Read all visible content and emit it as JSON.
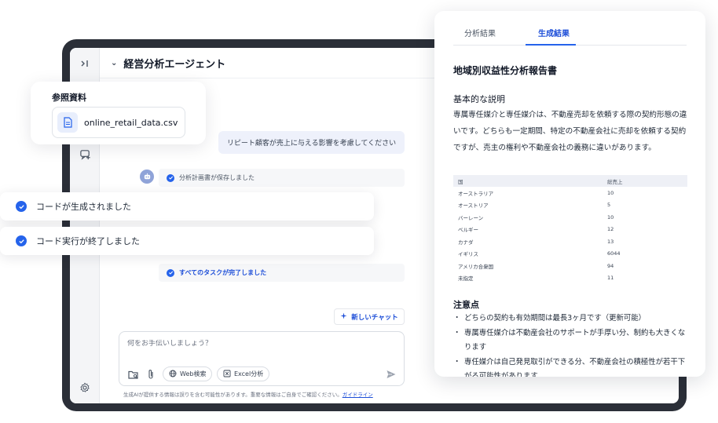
{
  "app": {
    "title": "経営分析エージェント"
  },
  "chat": {
    "user_message": "リピート顧客が売上に与える影響を考慮してください",
    "status_plan_saved": "分析計画書が保存しました",
    "status_all_done": "すべてのタスクが完了しました",
    "new_chat_label": "新しいチャット",
    "input_placeholder": "何をお手伝いしましょう？",
    "web_search_label": "Web検索",
    "excel_label": "Excel分析",
    "disclaimer": "生成AIが提供する情報は誤りを含む可能性があります。重要な情報はご自身でご確認ください。",
    "guideline_link": "ガイドライン"
  },
  "reference": {
    "title": "参照資料",
    "file_name": "online_retail_data.csv"
  },
  "toasts": {
    "code_generated": "コードが生成されました",
    "code_executed": "コード実行が終了しました"
  },
  "panel": {
    "tab_analysis": "分析結果",
    "tab_generated": "生成結果",
    "report_title": "地域別収益性分析報告書",
    "section_basic": "基本的な説明",
    "basic_text": "専属専任媒介と専任媒介は、不動産売却を依頼する際の契約形態の違いです。どちらも一定期間、特定の不動産会社に売却を依頼する契約ですが、売主の権利や不動産会社の義務に違いがあります。",
    "table": {
      "headers": [
        "国",
        "総売上"
      ],
      "rows": [
        [
          "オーストラリア",
          "10"
        ],
        [
          "オーストリア",
          "5"
        ],
        [
          "バーレーン",
          "10"
        ],
        [
          "ベルギー",
          "12"
        ],
        [
          "カナダ",
          "13"
        ],
        [
          "イギリス",
          "6044"
        ],
        [
          "アメリカ合衆国",
          "94"
        ],
        [
          "未指定",
          "11"
        ]
      ]
    },
    "section_notes": "注意点",
    "notes": [
      "どちらの契約も有効期間は最長3ヶ月です（更新可能）",
      "専属専任媒介は不動産会社のサポートが手厚い分、制約も大きくなります",
      "専任媒介は自己発見取引ができる分、不動産会社の積極性が若干下がる可能性があります"
    ]
  },
  "colors": {
    "accent": "#2563eb",
    "frame": "#2b2f38"
  }
}
